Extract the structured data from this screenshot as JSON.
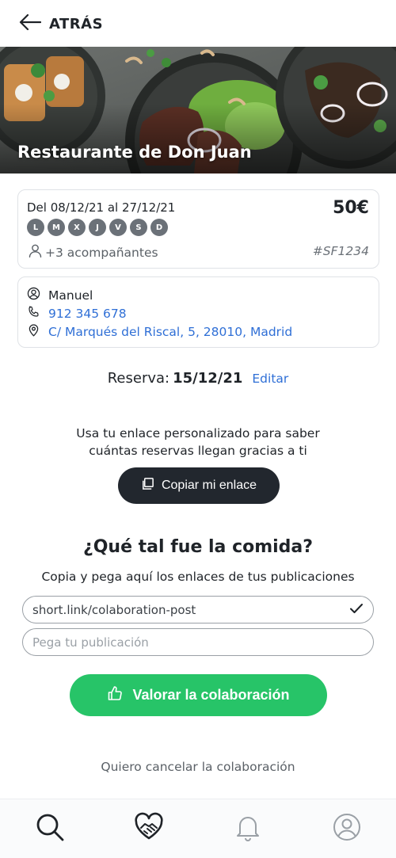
{
  "header": {
    "back_label": "ATRÁS"
  },
  "restaurant": {
    "name": "Restaurante de Don Juan"
  },
  "booking": {
    "dates": "Del 08/12/21 al 27/12/21",
    "price": "50€",
    "days": [
      "L",
      "M",
      "X",
      "J",
      "V",
      "S",
      "D"
    ],
    "companions": "+3 acompañantes",
    "code": "#SF1234"
  },
  "contact": {
    "name": "Manuel",
    "phone": "912 345 678",
    "address": "C/ Marqués del Riscal, 5, 28010, Madrid"
  },
  "reservation": {
    "label": "Reserva:",
    "date": "15/12/21",
    "edit_label": "Editar"
  },
  "promo": {
    "line1": "Usa tu enlace personalizado para saber",
    "line2": "cuántas reservas llegan gracias a ti",
    "copy_label": "Copiar mi enlace"
  },
  "review": {
    "title": "¿Qué tal fue la comida?",
    "subtitle": "Copia y pega aquí los enlaces de tus publicaciones",
    "link_value": "short.link/colaboration-post",
    "placeholder": "Pega tu publicación",
    "rate_label": "Valorar la colaboración"
  },
  "cancel_label": "Quiero cancelar la colaboración",
  "colors": {
    "accent_green": "#27c468",
    "link_blue": "#2f6fd6",
    "dark_button": "#22272e"
  },
  "nav": {
    "items": [
      {
        "icon": "search-icon"
      },
      {
        "icon": "heart-handshake-icon"
      },
      {
        "icon": "bell-icon"
      },
      {
        "icon": "user-icon"
      }
    ]
  }
}
